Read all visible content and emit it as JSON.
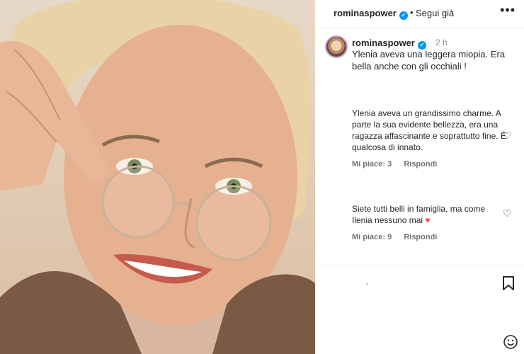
{
  "header": {
    "username": "rominaspower",
    "separator": "•",
    "follow_label": "Segui già",
    "more_icon": "more-dots-icon"
  },
  "caption": {
    "username": "rominaspower",
    "time": "2 h",
    "text": "Ylenia aveva una leggera miopia. Era bella anche con gli occhiali !"
  },
  "comments": [
    {
      "text": "Ylenia aveva un grandissimo charme. A parte la sua evidente bellezza, era una ragazza affascinante e soprattutto fine. È qualcosa di innato.",
      "likes": "Mi piace: 3",
      "reply": "Rispondi"
    },
    {
      "text": "Siete tutti belli in famiglia, ma come Ilenia nessuno mai",
      "emoji": "♥",
      "likes": "Mi piace: 9",
      "reply": "Rispondi"
    }
  ],
  "icons": {
    "verified": "verified-badge-icon",
    "heart": "heart-outline-icon",
    "bookmark": "bookmark-icon",
    "emoji": "emoji-smile-icon"
  },
  "colors": {
    "verified": "#0095f6",
    "text": "#262626",
    "muted": "#8e8e8e",
    "heart_red": "#ed4956"
  }
}
